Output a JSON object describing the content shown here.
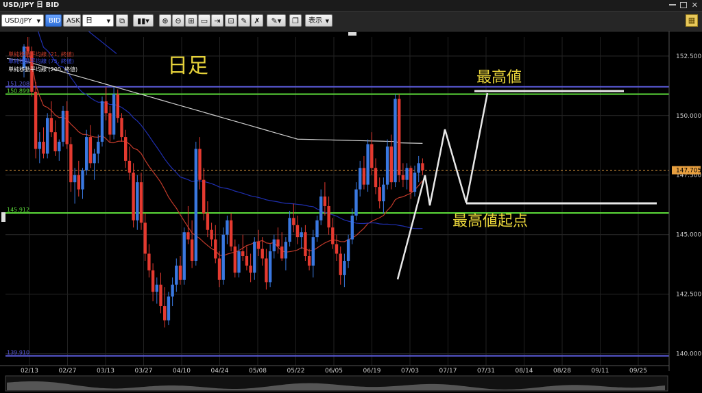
{
  "window": {
    "title": "USD/JPY 日 BID",
    "close_glyph": "✕"
  },
  "toolbar": {
    "symbol": "USD/JPY",
    "bid_label": "BID",
    "ask_label": "ASK",
    "timeframe": "日",
    "display_label": "表示"
  },
  "legend": {
    "sma21": "単純移動平均線 (21, 終値)",
    "sma75": "単純移動平均線 (75, 終値)",
    "sma200": "単純移動平均線 (200, 終値)"
  },
  "annotations": {
    "chart_title": "日足",
    "high_label": "最高値",
    "start_label": "最高値起点"
  },
  "colors": {
    "up": "#3a78e0",
    "down": "#e53a30",
    "sma21": "#c23a2a",
    "sma75": "#1f2fb0",
    "sma200": "#cfcfcf",
    "green_line": "#5cdc3a",
    "blue_line": "#5a5ad8",
    "current": "#e8a040",
    "annot": "#e6d23a"
  },
  "chart_data": {
    "type": "candlestick",
    "y_ticks": [
      "152.500",
      "150.000",
      "147.500",
      "145.000",
      "142.500",
      "140.000"
    ],
    "x_ticks": [
      "02/13",
      "02/27",
      "03/13",
      "03/27",
      "04/10",
      "04/24",
      "05/08",
      "05/22",
      "06/05",
      "06/19",
      "07/03",
      "07/17",
      "07/31",
      "08/14",
      "08/28",
      "09/11",
      "09/25"
    ],
    "ylim": [
      139.5,
      153.3
    ],
    "horizontal_lines": [
      {
        "value": 151.208,
        "label": "151.208",
        "color": "#5a5ad8"
      },
      {
        "value": 150.899,
        "label": "150.899",
        "color": "#5cdc3a"
      },
      {
        "value": 145.912,
        "label": "145.912",
        "color": "#5cdc3a"
      },
      {
        "value": 139.91,
        "label": "139.910",
        "color": "#5a5ad8"
      }
    ],
    "current_price": {
      "value": 147.705,
      "label": "147.705"
    },
    "candles": [
      [
        152.0,
        153.0,
        151.6,
        152.9
      ],
      [
        152.9,
        153.3,
        152.4,
        152.7
      ],
      [
        152.7,
        152.9,
        150.8,
        151.0
      ],
      [
        151.0,
        151.4,
        148.2,
        148.6
      ],
      [
        148.6,
        149.3,
        148.0,
        148.9
      ],
      [
        148.9,
        149.5,
        148.2,
        148.4
      ],
      [
        148.4,
        150.1,
        148.2,
        149.9
      ],
      [
        149.9,
        150.6,
        149.1,
        149.3
      ],
      [
        149.3,
        149.8,
        148.3,
        148.5
      ],
      [
        148.5,
        149.0,
        148.1,
        148.9
      ],
      [
        148.9,
        150.4,
        148.7,
        150.2
      ],
      [
        150.2,
        150.6,
        148.6,
        148.8
      ],
      [
        148.8,
        149.1,
        146.8,
        147.2
      ],
      [
        147.2,
        147.8,
        146.3,
        147.5
      ],
      [
        147.5,
        148.1,
        146.6,
        146.9
      ],
      [
        146.9,
        147.8,
        146.5,
        147.7
      ],
      [
        147.7,
        149.4,
        147.5,
        149.1
      ],
      [
        149.1,
        149.6,
        147.8,
        148.0
      ],
      [
        148.0,
        148.6,
        147.3,
        148.4
      ],
      [
        148.4,
        149.2,
        148.0,
        148.9
      ],
      [
        148.9,
        150.8,
        148.7,
        150.6
      ],
      [
        150.6,
        151.2,
        149.8,
        150.1
      ],
      [
        150.1,
        150.4,
        148.9,
        149.2
      ],
      [
        149.2,
        151.2,
        149.0,
        150.9
      ],
      [
        150.9,
        151.1,
        149.7,
        149.9
      ],
      [
        149.9,
        150.1,
        148.9,
        149.1
      ],
      [
        149.1,
        149.4,
        147.8,
        148.1
      ],
      [
        148.1,
        148.7,
        147.3,
        147.6
      ],
      [
        147.6,
        148.0,
        145.3,
        145.6
      ],
      [
        145.6,
        147.5,
        145.2,
        147.2
      ],
      [
        147.2,
        147.6,
        145.2,
        145.5
      ],
      [
        145.5,
        145.9,
        143.9,
        144.2
      ],
      [
        144.2,
        144.6,
        143.2,
        143.5
      ],
      [
        143.5,
        143.8,
        142.2,
        142.6
      ],
      [
        142.6,
        143.2,
        142.1,
        142.9
      ],
      [
        142.9,
        143.4,
        141.7,
        142.0
      ],
      [
        142.0,
        142.8,
        141.1,
        141.4
      ],
      [
        141.4,
        142.6,
        141.2,
        142.4
      ],
      [
        142.4,
        143.2,
        142.0,
        142.9
      ],
      [
        142.9,
        144.0,
        142.6,
        143.7
      ],
      [
        143.7,
        144.1,
        142.9,
        143.1
      ],
      [
        143.1,
        145.3,
        142.9,
        145.1
      ],
      [
        145.1,
        146.2,
        144.6,
        144.8
      ],
      [
        144.8,
        145.6,
        143.6,
        143.9
      ],
      [
        143.9,
        148.9,
        143.7,
        148.6
      ],
      [
        148.6,
        149.1,
        146.9,
        147.3
      ],
      [
        147.3,
        147.8,
        145.6,
        145.9
      ],
      [
        145.9,
        146.4,
        144.9,
        145.2
      ],
      [
        145.2,
        145.5,
        144.5,
        144.8
      ],
      [
        144.8,
        145.4,
        143.8,
        144.0
      ],
      [
        144.0,
        144.3,
        142.8,
        143.1
      ],
      [
        143.1,
        145.3,
        142.9,
        145.0
      ],
      [
        145.0,
        145.8,
        144.6,
        145.6
      ],
      [
        145.6,
        145.9,
        144.3,
        144.5
      ],
      [
        144.5,
        144.8,
        143.2,
        143.4
      ],
      [
        143.4,
        144.6,
        143.2,
        144.3
      ],
      [
        144.3,
        145.0,
        143.9,
        144.1
      ],
      [
        144.1,
        144.5,
        143.5,
        143.7
      ],
      [
        143.7,
        144.2,
        143.0,
        143.4
      ],
      [
        143.4,
        144.9,
        143.1,
        144.7
      ],
      [
        144.7,
        145.2,
        144.1,
        144.4
      ],
      [
        144.4,
        144.9,
        143.7,
        144.0
      ],
      [
        144.0,
        144.4,
        142.7,
        143.0
      ],
      [
        143.0,
        144.6,
        142.8,
        144.3
      ],
      [
        144.3,
        145.0,
        144.0,
        144.8
      ],
      [
        144.8,
        145.3,
        144.2,
        144.5
      ],
      [
        144.5,
        145.1,
        143.9,
        144.0
      ],
      [
        144.0,
        144.9,
        143.5,
        144.7
      ],
      [
        144.7,
        146.0,
        144.5,
        145.7
      ],
      [
        145.7,
        146.3,
        145.1,
        145.4
      ],
      [
        145.4,
        145.8,
        144.6,
        144.9
      ],
      [
        144.9,
        145.3,
        144.4,
        145.1
      ],
      [
        145.1,
        145.4,
        143.9,
        144.1
      ],
      [
        144.1,
        144.4,
        143.5,
        143.7
      ],
      [
        143.7,
        145.2,
        143.2,
        144.9
      ],
      [
        144.9,
        145.8,
        144.7,
        145.6
      ],
      [
        145.6,
        146.9,
        145.4,
        146.6
      ],
      [
        146.6,
        147.2,
        145.8,
        146.2
      ],
      [
        146.2,
        146.6,
        145.0,
        145.3
      ],
      [
        145.3,
        145.7,
        144.4,
        144.6
      ],
      [
        144.6,
        145.0,
        143.9,
        144.2
      ],
      [
        144.2,
        144.5,
        142.9,
        143.3
      ],
      [
        143.3,
        144.2,
        142.8,
        143.9
      ],
      [
        143.9,
        145.0,
        143.6,
        144.8
      ],
      [
        144.8,
        146.1,
        144.6,
        145.8
      ],
      [
        145.8,
        147.2,
        145.6,
        146.9
      ],
      [
        146.9,
        148.1,
        146.6,
        147.8
      ],
      [
        147.8,
        148.3,
        146.9,
        147.1
      ],
      [
        147.1,
        149.0,
        146.8,
        148.8
      ],
      [
        148.8,
        149.3,
        147.5,
        147.8
      ],
      [
        147.8,
        148.2,
        146.7,
        147.0
      ],
      [
        147.0,
        147.4,
        146.1,
        146.4
      ],
      [
        146.4,
        147.4,
        145.9,
        147.1
      ],
      [
        147.1,
        149.0,
        146.9,
        148.7
      ],
      [
        148.7,
        149.2,
        146.9,
        147.2
      ],
      [
        147.2,
        150.9,
        147.0,
        150.7
      ],
      [
        150.7,
        150.9,
        147.2,
        147.5
      ],
      [
        147.5,
        148.0,
        147.0,
        147.3
      ],
      [
        147.3,
        148.0,
        146.9,
        147.8
      ],
      [
        147.8,
        147.9,
        146.5,
        146.8
      ],
      [
        146.8,
        147.9,
        146.6,
        147.6
      ],
      [
        147.6,
        148.3,
        147.2,
        148.0
      ],
      [
        148.0,
        148.2,
        147.5,
        147.7
      ]
    ]
  }
}
